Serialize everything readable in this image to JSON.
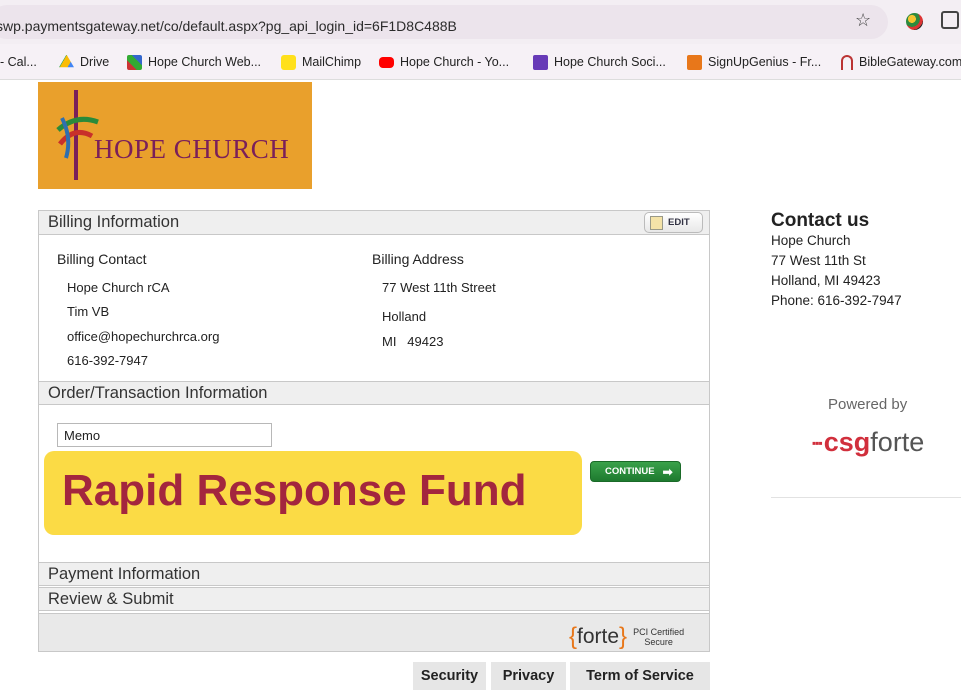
{
  "browser": {
    "url": "swp.paymentsgateway.net/co/default.aspx?pg_api_login_id=6F1D8C488B",
    "bookmarks": [
      "- Cal...",
      "Drive",
      "Hope Church Web...",
      "MailChimp",
      "Hope Church - Yo...",
      "Hope Church Soci...",
      "SignUpGenius - Fr...",
      "BibleGateway.com"
    ]
  },
  "logo": {
    "text": "HOPE CHURCH"
  },
  "billing": {
    "header": "Billing Information",
    "edit_label": "EDIT",
    "contact_label": "Billing Contact",
    "contact": [
      "Hope Church rCA",
      "Tim VB",
      "office@hopechurchrca.org",
      "616-392-7947"
    ],
    "address_label": "Billing Address",
    "address": [
      "77 West 11th Street",
      "Holland",
      "MI   49423"
    ]
  },
  "order": {
    "header": "Order/Transaction Information",
    "memo_value": "Memo",
    "banner": "Rapid Response Fund",
    "continue_label": "CONTINUE"
  },
  "payment": {
    "header": "Payment Information"
  },
  "review": {
    "header": "Review & Submit"
  },
  "badge": {
    "forte": "forte",
    "pci_line1": "PCI Certified",
    "pci_line2": "Secure"
  },
  "footer_links": [
    "Security",
    "Privacy",
    "Term of Service"
  ],
  "contact": {
    "title": "Contact us",
    "lines": [
      "Hope Church",
      "77 West 11th St",
      "Holland, MI 49423",
      "Phone: 616-392-7947"
    ]
  },
  "powered": {
    "label": "Powered by",
    "brand_csg": "csg",
    "brand_forte": "forte"
  },
  "colors": {
    "logo_bg": "#e9a02c",
    "banner_bg": "#fbdb45",
    "banner_text": "#a3263e",
    "continue_bg": "#2e8f3f"
  }
}
